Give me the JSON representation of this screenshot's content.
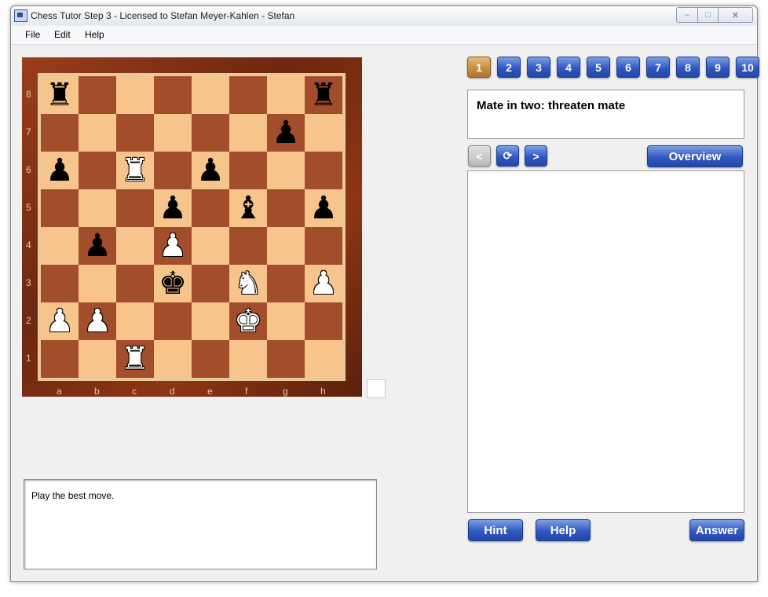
{
  "window": {
    "title": "Chess Tutor Step 3 - Licensed to Stefan Meyer-Kahlen - Stefan",
    "controls": {
      "minimize": "–",
      "maximize": "□",
      "close": "✕"
    }
  },
  "menu": {
    "file": "File",
    "edit": "Edit",
    "help": "Help"
  },
  "board": {
    "ranks": [
      "8",
      "7",
      "6",
      "5",
      "4",
      "3",
      "2",
      "1"
    ],
    "files": [
      "a",
      "b",
      "c",
      "d",
      "e",
      "f",
      "g",
      "h"
    ],
    "position": [
      [
        "bR",
        "",
        "",
        "",
        "",
        "",
        "",
        "bR"
      ],
      [
        "",
        "",
        "",
        "",
        "",
        "",
        "bP",
        ""
      ],
      [
        "bP",
        "",
        "wR",
        "",
        "bP",
        "",
        "",
        ""
      ],
      [
        "",
        "",
        "",
        "bP",
        "",
        "bB",
        "",
        "bP"
      ],
      [
        "",
        "bP",
        "",
        "wP",
        "",
        "",
        "",
        ""
      ],
      [
        "",
        "",
        "",
        "bK",
        "",
        "wN",
        "",
        "wP"
      ],
      [
        "wP",
        "wP",
        "",
        "",
        "",
        "wK",
        "",
        ""
      ],
      [
        "",
        "",
        "wR",
        "",
        "",
        "",
        "",
        ""
      ]
    ],
    "pieces": {
      "wK": "♚",
      "wQ": "♛",
      "wR": "♜",
      "wB": "♝",
      "wN": "♞",
      "wP": "♟",
      "bK": "♚",
      "bQ": "♛",
      "bR": "♜",
      "bB": "♝",
      "bN": "♞",
      "bP": "♟"
    }
  },
  "info_text": "Play the best move.",
  "exercise_tabs": [
    "1",
    "2",
    "3",
    "4",
    "5",
    "6",
    "7",
    "8",
    "9",
    "10"
  ],
  "active_tab_index": 0,
  "task_text": "Mate in two: threaten mate",
  "nav": {
    "back": "<",
    "refresh": "⟳",
    "forward": ">",
    "overview": "Overview"
  },
  "bottom_buttons": {
    "hint": "Hint",
    "help": "Help",
    "answer": "Answer"
  },
  "colors": {
    "button_blue": "#2f58c2",
    "active_tab": "#c98d45",
    "light_square": "#f7c48c",
    "dark_square": "#a34e2b"
  }
}
